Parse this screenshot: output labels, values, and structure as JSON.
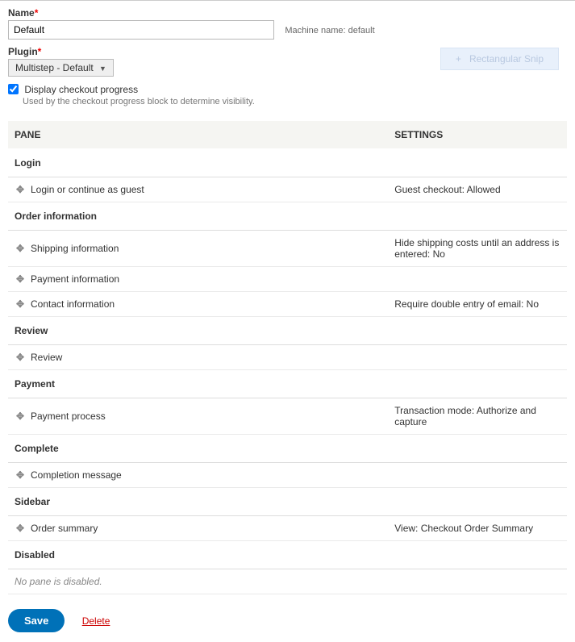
{
  "form": {
    "name_label": "Name",
    "name_value": "Default",
    "machine_name_label": "Machine name:",
    "machine_name_value": "default",
    "plugin_label": "Plugin",
    "plugin_value": "Multistep - Default",
    "display_progress_label": "Display checkout progress",
    "display_progress_hint": "Used by the checkout progress block to determine visibility."
  },
  "snip_button": "Rectangular Snip",
  "table": {
    "header_pane": "PANE",
    "header_settings": "SETTINGS"
  },
  "sections": [
    {
      "title": "Login",
      "rows": [
        {
          "pane": "Login or continue as guest",
          "settings": "Guest checkout: Allowed"
        }
      ]
    },
    {
      "title": "Order information",
      "rows": [
        {
          "pane": "Shipping information",
          "settings": "Hide shipping costs until an address is entered: No"
        },
        {
          "pane": "Payment information",
          "settings": ""
        },
        {
          "pane": "Contact information",
          "settings": "Require double entry of email: No"
        }
      ]
    },
    {
      "title": "Review",
      "rows": [
        {
          "pane": "Review",
          "settings": ""
        }
      ]
    },
    {
      "title": "Payment",
      "rows": [
        {
          "pane": "Payment process",
          "settings": "Transaction mode: Authorize and capture"
        }
      ]
    },
    {
      "title": "Complete",
      "rows": [
        {
          "pane": "Completion message",
          "settings": ""
        }
      ]
    },
    {
      "title": "Sidebar",
      "rows": [
        {
          "pane": "Order summary",
          "settings": "View: Checkout Order Summary"
        }
      ]
    },
    {
      "title": "Disabled",
      "empty": "No pane is disabled."
    }
  ],
  "actions": {
    "save": "Save",
    "delete": "Delete"
  }
}
